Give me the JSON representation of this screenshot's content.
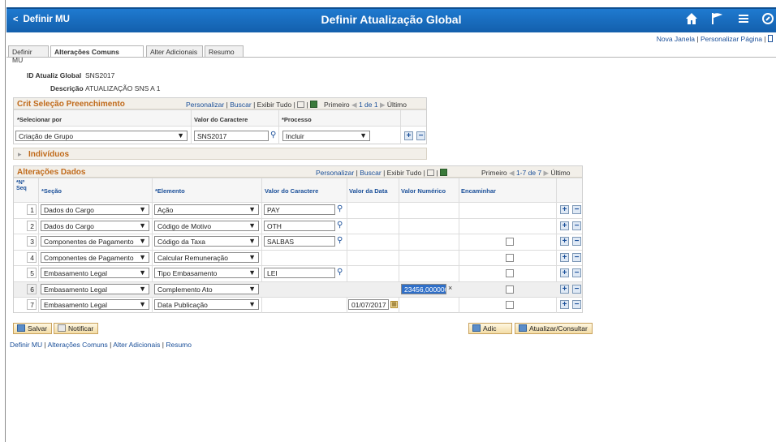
{
  "header": {
    "back_label": "Definir MU",
    "title": "Definir Atualização Global",
    "icons": [
      "home-icon",
      "flag-icon",
      "menu-icon",
      "navbar-icon"
    ]
  },
  "toplinks": {
    "new_window": "Nova Janela",
    "sep": "|",
    "personalize": "Personalizar Página",
    "sep2": "|"
  },
  "tabs": [
    {
      "label": "Definir MU",
      "active": false
    },
    {
      "label": "Alterações Comuns",
      "active": true
    },
    {
      "label": "Alter Adicionais",
      "active": false
    },
    {
      "label": "Resumo",
      "active": false
    }
  ],
  "fields": {
    "id_label": "ID Atualiz Global",
    "id_value": "SNS2017",
    "desc_label": "Descrição",
    "desc_value": "ATUALIZAÇÃO SNS A 1"
  },
  "crit": {
    "title": "Crit Seleção Preenchimento",
    "nav_personalize": "Personalizar",
    "nav_find": "Buscar",
    "nav_view_all": "Exibir Tudo",
    "nav_first": "Primeiro",
    "nav_range": "1 de 1",
    "nav_last": "Último",
    "sep": "|",
    "col_select": "*Selecionar por",
    "col_value": "Valor do Caractere",
    "col_process": "*Processo",
    "select_value": "Criação de Grupo",
    "char_value": "SNS2017",
    "process_value": "Incluir"
  },
  "individuals": {
    "title": "Indivíduos"
  },
  "changes": {
    "title": "Alterações Dados",
    "nav_personalize": "Personalizar",
    "nav_find": "Buscar",
    "nav_view_all": "Exibir Tudo",
    "nav_first": "Primeiro",
    "nav_range": "1-7 de 7",
    "nav_last": "Último",
    "sep": "|",
    "col_seq_1": "*Nº",
    "col_seq_2": "Seq",
    "col_section": "*Seção",
    "col_element": "*Elemento",
    "col_char": "Valor do Caractere",
    "col_date": "Valor da Data",
    "col_num": "Valor Numérico",
    "col_forward": "Encaminhar",
    "rows": [
      {
        "seq": "1",
        "section": "Dados do Cargo",
        "element": "Ação",
        "char": "PAY",
        "date": "",
        "num": "",
        "checkbox": false
      },
      {
        "seq": "2",
        "section": "Dados do Cargo",
        "element": "Código de Motivo",
        "char": "OTH",
        "date": "",
        "num": "",
        "checkbox": false
      },
      {
        "seq": "3",
        "section": "Componentes de Pagamento",
        "element": "Código da Taxa",
        "char": "SALBAS",
        "date": "",
        "num": "",
        "checkbox": true
      },
      {
        "seq": "4",
        "section": "Componentes de Pagamento",
        "element": "Calcular Remuneração",
        "char": "",
        "date": "",
        "num": "",
        "checkbox": true
      },
      {
        "seq": "5",
        "section": "Embasamento Legal",
        "element": "Tipo Embasamento",
        "char": "LEI",
        "date": "",
        "num": "",
        "checkbox": true
      },
      {
        "seq": "6",
        "section": "Embasamento Legal",
        "element": "Complemento Ato",
        "char": "",
        "date": "",
        "num": "23456,000000",
        "checkbox": true
      },
      {
        "seq": "7",
        "section": "Embasamento Legal",
        "element": "Data Publicação",
        "char": "",
        "date": "01/07/2017",
        "num": "",
        "checkbox": true
      }
    ]
  },
  "buttons": {
    "save": "Salvar",
    "notify": "Notificar",
    "add": "Adic",
    "update": "Atualizar/Consultar",
    "plus": "+",
    "minus": "−",
    "clear": "×",
    "dropdown": "▾",
    "lookup": "🔍",
    "expand": "▸",
    "calendar": "▦"
  },
  "bottomlinks": {
    "l1": "Definir MU",
    "l2": "Alterações Comuns",
    "l3": "Alter Adicionais",
    "l4": "Resumo",
    "sep": " | "
  },
  "colors": {
    "banner": "#1a6dc0",
    "section_title": "#c06a1a",
    "link": "#1a4f99",
    "highlight": "#2f6fc8"
  }
}
